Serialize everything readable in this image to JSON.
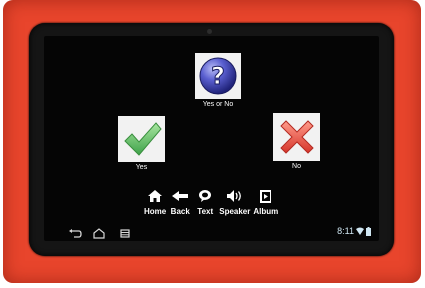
{
  "tiles": {
    "question": {
      "label": "Yes or No",
      "glyph": "?"
    },
    "yes": {
      "label": "Yes"
    },
    "no": {
      "label": "No"
    }
  },
  "toolbar": {
    "home_label": "Home",
    "back_label": "Back",
    "text_label": "Text",
    "speaker_label": "Speaker",
    "album_label": "Album"
  },
  "status": {
    "time": "8:11"
  },
  "colors": {
    "case": "#e8452c",
    "check": "#5cc05c",
    "cross": "#e0463c",
    "question_ball": "#3b3fb8"
  }
}
